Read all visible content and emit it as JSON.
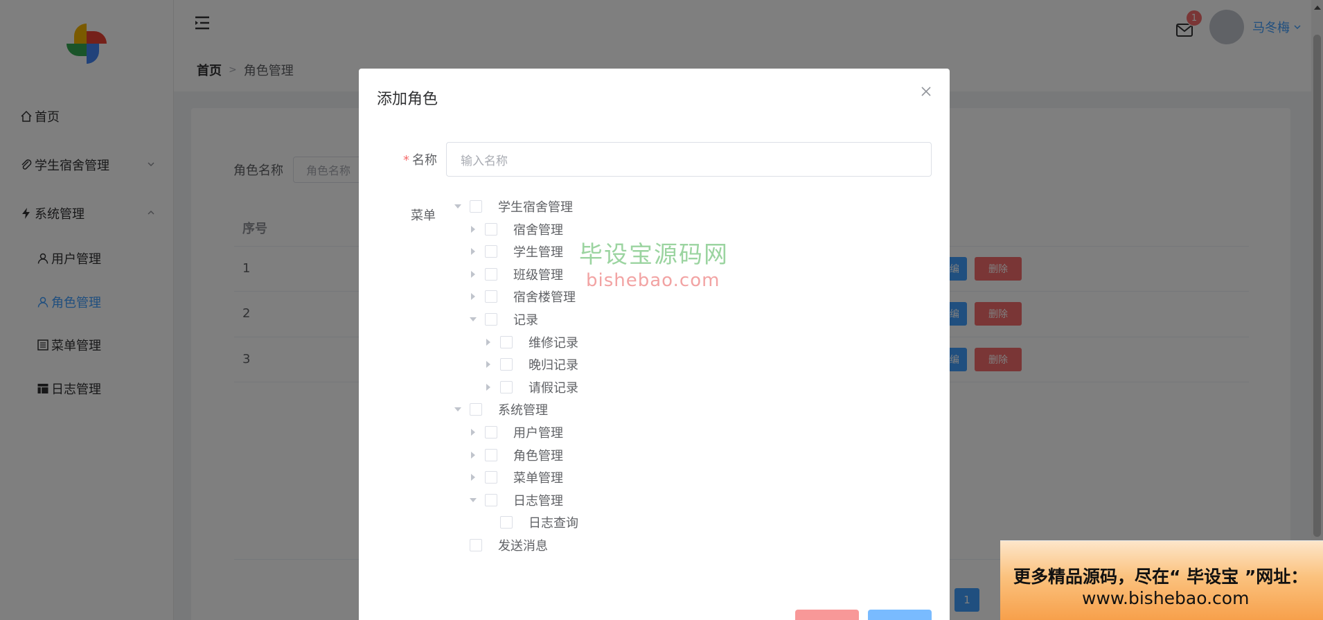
{
  "sidebar": {
    "items": [
      {
        "label": "首页",
        "icon": "home-icon"
      },
      {
        "label": "学生宿舍管理",
        "icon": "paperclip-icon",
        "expandable": true,
        "expanded": false
      },
      {
        "label": "系统管理",
        "icon": "lightning-icon",
        "expandable": true,
        "expanded": true
      },
      {
        "label": "用户管理",
        "icon": "user-icon"
      },
      {
        "label": "角色管理",
        "icon": "user-icon",
        "active": true
      },
      {
        "label": "菜单管理",
        "icon": "list-icon"
      },
      {
        "label": "日志管理",
        "icon": "table-icon"
      }
    ]
  },
  "header": {
    "breadcrumb": {
      "home": "首页",
      "current": "角色管理"
    },
    "notification_count": "1",
    "username": "马冬梅"
  },
  "page": {
    "search_label": "角色名称",
    "search_placeholder": "角色名称",
    "table_header_index": "序号",
    "rows": [
      {
        "index": "1",
        "edit": "编",
        "delete": "删除"
      },
      {
        "index": "2",
        "edit": "编",
        "delete": "删除"
      },
      {
        "index": "3",
        "edit": "编",
        "delete": "删除"
      }
    ],
    "current_page": "1"
  },
  "dialog": {
    "title": "添加角色",
    "name_label": "名称",
    "name_placeholder": "输入名称",
    "menu_label": "菜单",
    "tree": [
      {
        "label": "学生宿舍管理",
        "caret": "down"
      },
      {
        "label": "宿舍管理",
        "caret": "right"
      },
      {
        "label": "学生管理",
        "caret": "right"
      },
      {
        "label": "班级管理",
        "caret": "right"
      },
      {
        "label": "宿舍楼管理",
        "caret": "right"
      },
      {
        "label": "记录",
        "caret": "down"
      },
      {
        "label": "维修记录",
        "caret": "right"
      },
      {
        "label": "晚归记录",
        "caret": "right"
      },
      {
        "label": "请假记录",
        "caret": "right"
      },
      {
        "label": "系统管理",
        "caret": "down"
      },
      {
        "label": "用户管理",
        "caret": "right"
      },
      {
        "label": "角色管理",
        "caret": "right"
      },
      {
        "label": "菜单管理",
        "caret": "right"
      },
      {
        "label": "日志管理",
        "caret": "down"
      },
      {
        "label": "日志查询",
        "caret": "none"
      },
      {
        "label": "发送消息",
        "caret": "none"
      }
    ]
  },
  "watermark": {
    "cn": "毕设宝源码网",
    "en": "bishebao.com"
  },
  "promo": {
    "line1": "更多精品源码，尽在“ 毕设宝 ”网址：",
    "line2": "www.bishebao.com"
  },
  "colors": {
    "primary": "#409eff",
    "danger": "#f56c6c",
    "overlay": "rgba(0,0,0,0.5)"
  }
}
